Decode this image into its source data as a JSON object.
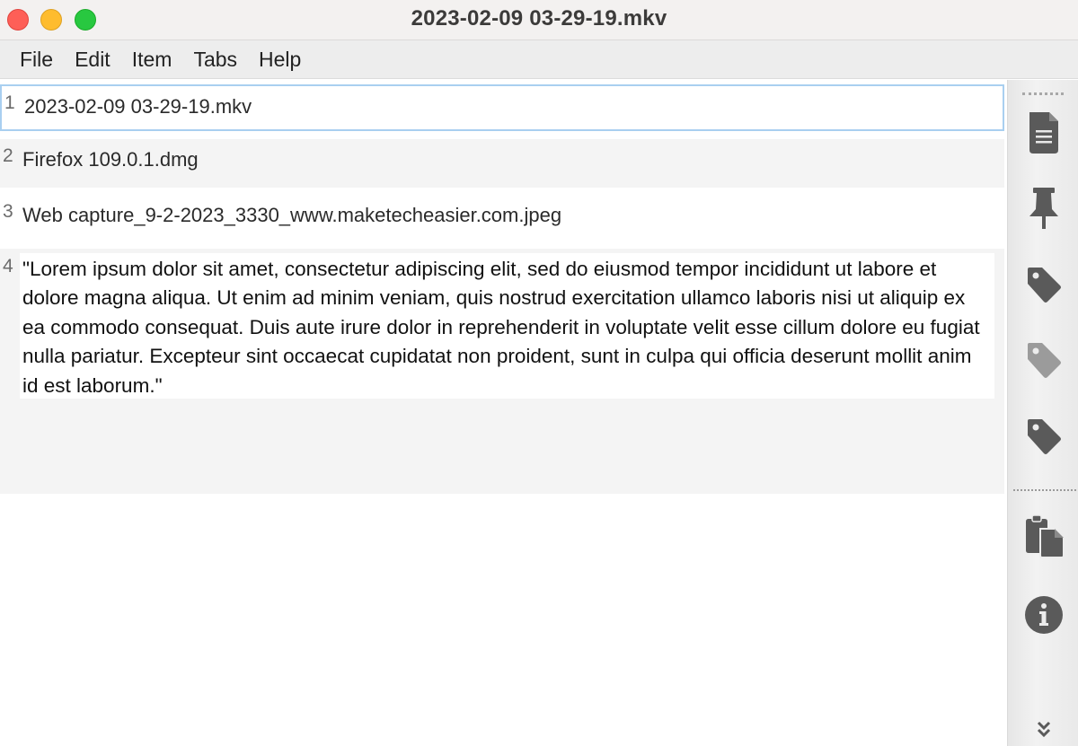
{
  "window": {
    "title": "2023-02-09 03-29-19.mkv"
  },
  "menu": {
    "file": "File",
    "edit": "Edit",
    "item": "Item",
    "tabs": "Tabs",
    "help": "Help"
  },
  "items": [
    {
      "number": "1",
      "text": "2023-02-09 03-29-19.mkv"
    },
    {
      "number": "2",
      "text": "Firefox 109.0.1.dmg"
    },
    {
      "number": "3",
      "text": "Web capture_9-2-2023_3330_www.maketecheasier.com.jpeg"
    },
    {
      "number": "4",
      "text": "\"Lorem ipsum dolor sit amet, consectetur adipiscing elit, sed do eiusmod tempor incididunt ut labore et dolore magna aliqua. Ut enim ad minim veniam, quis nostrud exercitation ullamco laboris nisi ut aliquip ex ea commodo consequat. Duis aute irure dolor in reprehenderit in voluptate velit esse cillum dolore eu fugiat nulla pariatur. Excepteur sint occaecat cupidatat non proident, sunt in culpa qui officia deserunt mollit anim id est laborum.\""
    }
  ],
  "toolbar": {
    "icons": [
      "document-icon",
      "pin-icon",
      "tag-icon",
      "tag-icon",
      "tag-icon",
      "clipboard-icon",
      "info-icon",
      "chevron-double-down-icon"
    ]
  },
  "colors": {
    "selection_border": "#a9cff0",
    "icon": "#5a5a5a",
    "close": "#fe5f57",
    "minimize": "#febc2e",
    "maximize": "#28c840"
  }
}
